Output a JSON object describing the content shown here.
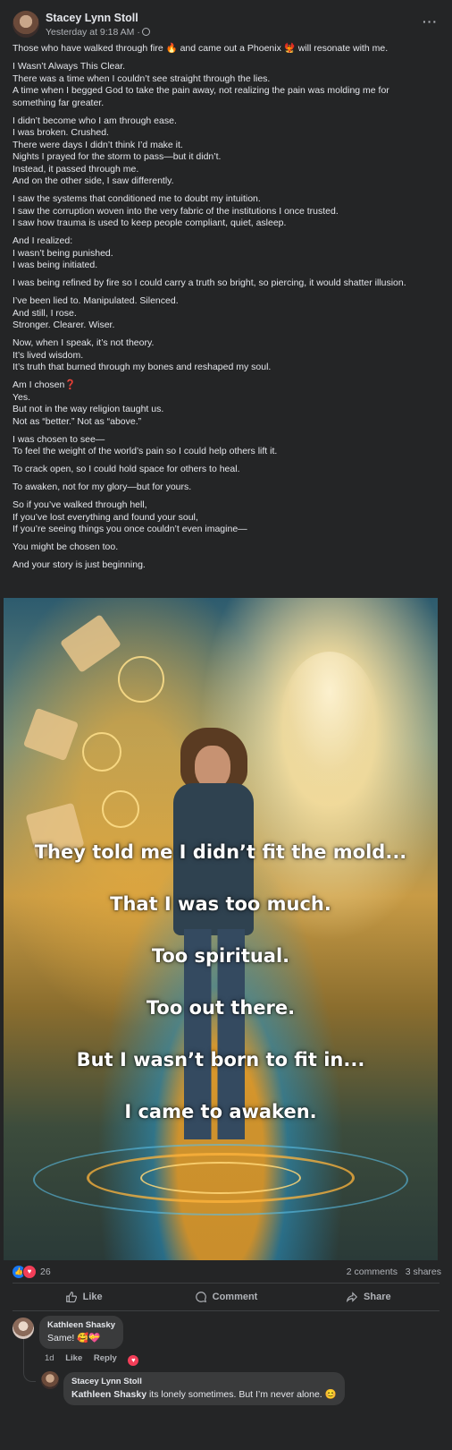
{
  "post": {
    "author": "Stacey Lynn Stoll",
    "timestamp": "Yesterday at 9:18 AM ·",
    "more_label": "···",
    "paragraphs": [
      [
        "Those who have walked through fire 🔥 and came out a Phoenix 🐦‍🔥 will resonate with me."
      ],
      [
        "I Wasn’t Always This Clear.",
        "There was a time when I couldn’t see straight through the lies.",
        "A time when I begged God to take the pain away, not realizing the pain was molding me for",
        "something far greater."
      ],
      [
        "I didn’t become who I am through ease.",
        "I was broken. Crushed.",
        "There were days I didn’t think I’d make it.",
        "Nights I prayed for the storm to pass—but it didn’t.",
        "Instead, it passed through me.",
        "And on the other side, I saw differently."
      ],
      [
        "I saw the systems that conditioned me to doubt my intuition.",
        "I saw the corruption woven into the very fabric of the institutions I once trusted.",
        "I saw how trauma is used to keep people compliant, quiet, asleep."
      ],
      [
        "And I realized:",
        "I wasn’t being punished.",
        "I was being initiated."
      ],
      [
        "I was being refined by fire so I could carry a truth so bright, so piercing, it would shatter illusion."
      ],
      [
        "I’ve been lied to. Manipulated. Silenced.",
        "And still, I rose.",
        "Stronger. Clearer. Wiser."
      ],
      [
        "Now, when I speak, it’s not theory.",
        "It’s lived wisdom.",
        "It’s truth that burned through my bones and reshaped my soul."
      ],
      [
        "Am I chosen❓",
        "Yes.",
        "But not in the way religion taught us.",
        "Not as “better.” Not as “above.”"
      ],
      [
        "I was chosen to see—",
        "To feel the weight of the world’s pain so I could help others lift it."
      ],
      [
        "To crack open, so I could hold space for others to heal."
      ],
      [
        "To awaken, not for my glory—but for yours."
      ],
      [
        "So if you’ve walked through hell,",
        "If you’ve lost everything and found your soul,",
        "If you’re seeing things you once couldn’t even imagine—"
      ],
      [
        "You might be chosen too."
      ],
      [
        "And your story is just beginning."
      ]
    ]
  },
  "image": {
    "quote_lines": [
      "They told me I didn’t fit the mold...",
      "That I was too much.",
      "Too spiritual.",
      "Too out there.",
      "But I wasn’t born to fit in...",
      "I came to awaken."
    ]
  },
  "stats": {
    "reaction_count": "26",
    "comments": "2 comments",
    "shares": "3 shares"
  },
  "actions": {
    "like": "Like",
    "comment": "Comment",
    "share": "Share"
  },
  "comments": [
    {
      "author": "Kathleen Shasky",
      "text": "Same! 🥰💝",
      "age": "1d",
      "like": "Like",
      "reply": "Reply"
    },
    {
      "author": "Stacey Lynn Stoll",
      "mention": "Kathleen Shasky",
      "text": " its lonely sometimes. But I’m never alone. 😊"
    }
  ],
  "colors": {
    "background": "#242526",
    "text": "#e4e6eb",
    "secondary": "#b0b3b8",
    "like_blue": "#1877f2",
    "love_red": "#f33e58"
  }
}
